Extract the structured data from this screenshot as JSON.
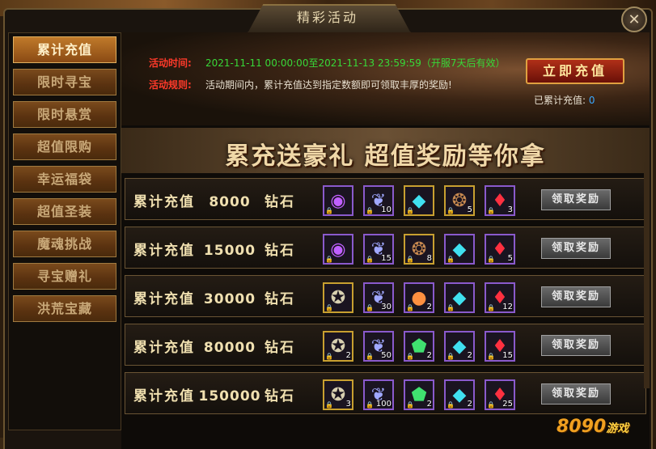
{
  "window": {
    "title": "精彩活动",
    "close_label": "✕"
  },
  "sidebar": {
    "items": [
      {
        "label": "累计充值",
        "active": true
      },
      {
        "label": "限时寻宝"
      },
      {
        "label": "限时悬赏"
      },
      {
        "label": "超值限购"
      },
      {
        "label": "幸运福袋"
      },
      {
        "label": "超值圣装"
      },
      {
        "label": "魔魂挑战"
      },
      {
        "label": "寻宝赠礼"
      },
      {
        "label": "洪荒宝藏"
      }
    ]
  },
  "banner": {
    "time_label": "活动时间:",
    "time_value": "2021-11-11 00:00:00至2021-11-13 23:59:59（开服7天后有效）",
    "rule_label": "活动规则:",
    "rule_value": "活动期间内，累计充值达到指定数额即可领取丰厚的奖励!",
    "recharge_button": "立即充值",
    "accumulated_label": "已累计充值:",
    "accumulated_value": "0"
  },
  "slogan": "累充送豪礼  超值奖励等你拿",
  "tiers": [
    {
      "prefix": "累计充值",
      "amount": "8000",
      "unit": "钻石",
      "claim": "领取奖励",
      "items": [
        {
          "icon": "purple-orb",
          "count": ""
        },
        {
          "icon": "feather",
          "count": "10"
        },
        {
          "icon": "cyan-gem",
          "count": ""
        },
        {
          "icon": "bronze-medal",
          "count": "5"
        },
        {
          "icon": "red-crystal",
          "count": "3"
        }
      ]
    },
    {
      "prefix": "累计充值",
      "amount": "15000",
      "unit": "钻石",
      "claim": "领取奖励",
      "items": [
        {
          "icon": "purple-orb",
          "count": ""
        },
        {
          "icon": "feather",
          "count": "15"
        },
        {
          "icon": "bronze-medal",
          "count": "8"
        },
        {
          "icon": "cyan-gem",
          "count": ""
        },
        {
          "icon": "red-crystal",
          "count": "5"
        }
      ]
    },
    {
      "prefix": "累计充值",
      "amount": "30000",
      "unit": "钻石",
      "claim": "领取奖励",
      "items": [
        {
          "icon": "silver-compass",
          "count": ""
        },
        {
          "icon": "feather",
          "count": "30"
        },
        {
          "icon": "rainbow-orb",
          "count": "2"
        },
        {
          "icon": "cyan-gem",
          "count": ""
        },
        {
          "icon": "red-crystal",
          "count": "12"
        }
      ]
    },
    {
      "prefix": "累计充值",
      "amount": "80000",
      "unit": "钻石",
      "claim": "领取奖励",
      "items": [
        {
          "icon": "silver-compass",
          "count": "2"
        },
        {
          "icon": "feather",
          "count": "50"
        },
        {
          "icon": "green-gem",
          "count": "2"
        },
        {
          "icon": "cyan-gem",
          "count": "2"
        },
        {
          "icon": "red-crystal",
          "count": "15"
        }
      ]
    },
    {
      "prefix": "累计充值",
      "amount": "150000",
      "unit": "钻石",
      "claim": "领取奖励",
      "items": [
        {
          "icon": "silver-compass",
          "count": "3"
        },
        {
          "icon": "feather",
          "count": "100"
        },
        {
          "icon": "green-gem",
          "count": "2"
        },
        {
          "icon": "cyan-gem",
          "count": "2"
        },
        {
          "icon": "red-crystal",
          "count": "25"
        }
      ]
    }
  ],
  "watermark": {
    "brand": "8090",
    "suffix": "游戏"
  }
}
